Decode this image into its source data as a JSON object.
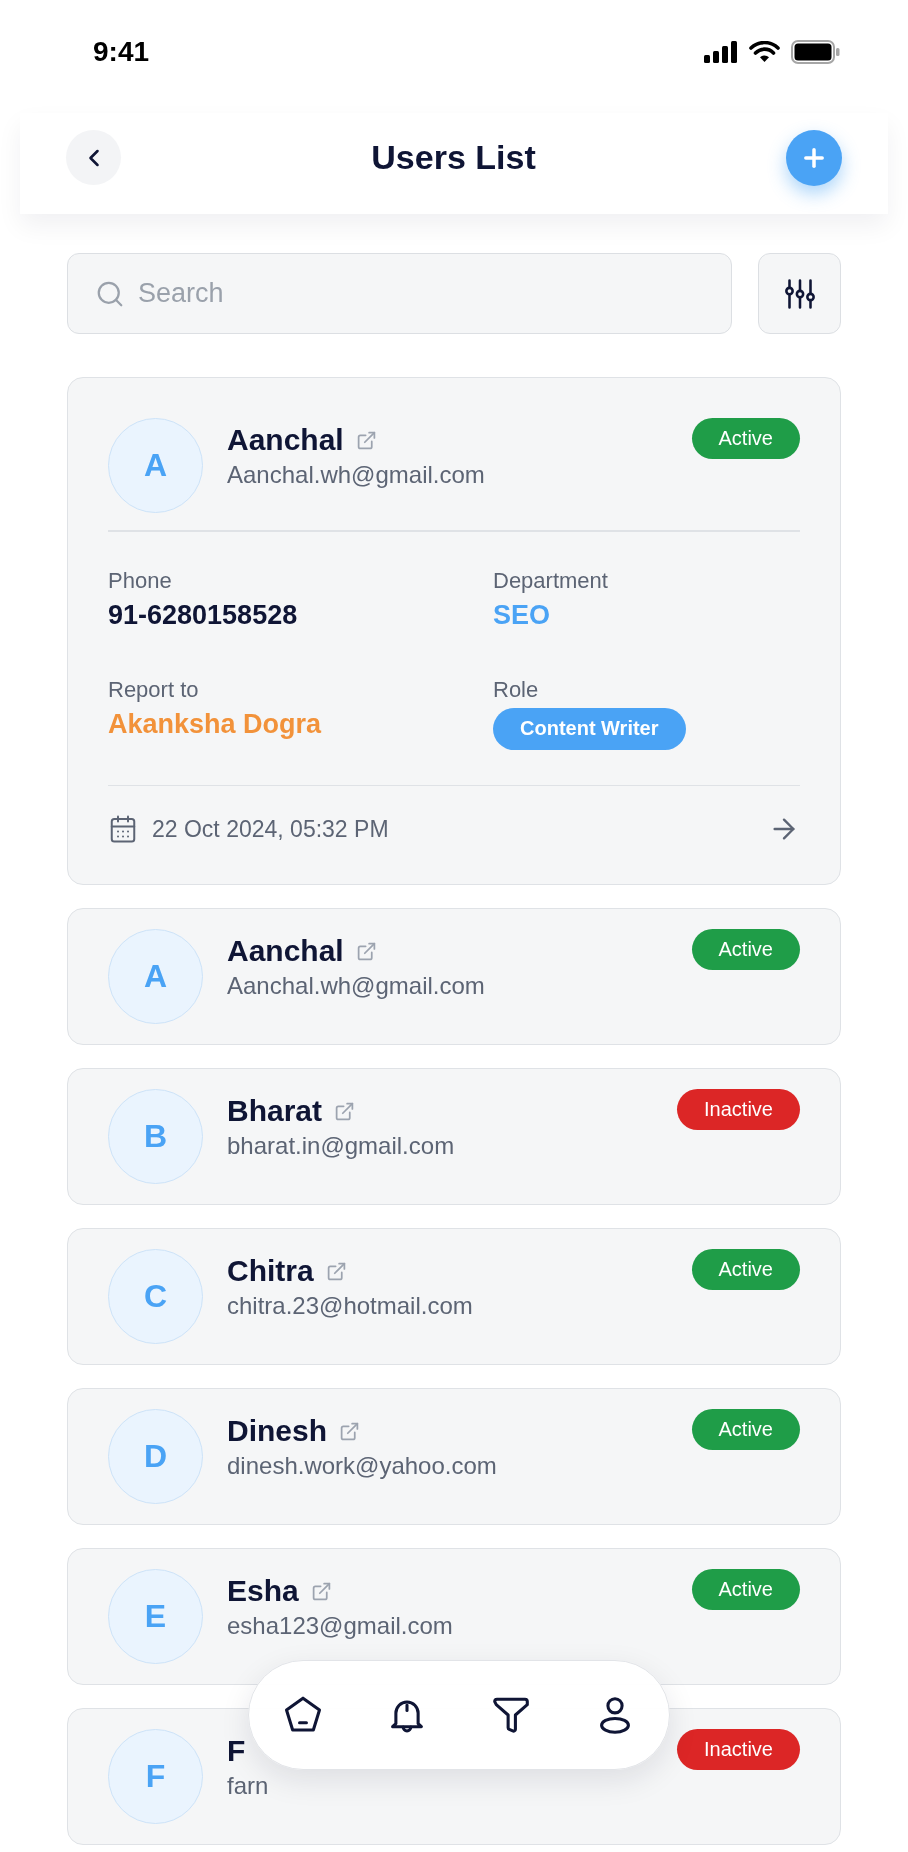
{
  "status_bar": {
    "time": "9:41"
  },
  "header": {
    "title": "Users List"
  },
  "search": {
    "placeholder": "Search"
  },
  "users": [
    {
      "initial": "A",
      "name": "Aanchal",
      "link_icon": true,
      "email": "Aanchal.wh@gmail.com",
      "status": "Active",
      "active": true,
      "fields": [
        {
          "kind": "plain",
          "label": "Phone",
          "value": "91-6280158528"
        },
        {
          "kind": "accent",
          "label": "Department",
          "value": "SEO"
        },
        {
          "kind": "highlight",
          "label": "Report to",
          "value": "Akanksha Dogra"
        },
        {
          "kind": "chip",
          "label": "Role",
          "value": "Content Writer"
        }
      ],
      "date": "22 Oct 2024, 05:32 PM"
    },
    {
      "initial": "A",
      "name": "Aanchal",
      "link_icon": true,
      "email": "Aanchal.wh@gmail.com",
      "status": "Active",
      "active": true
    },
    {
      "initial": "B",
      "name": "Bharat",
      "link_icon": true,
      "email": "bharat.in@gmail.com",
      "status": "Inactive",
      "active": false
    },
    {
      "initial": "C",
      "name": "Chitra",
      "link_icon": true,
      "email": "chitra.23@hotmail.com",
      "status": "Active",
      "active": true
    },
    {
      "initial": "D",
      "name": "Dinesh",
      "link_icon": true,
      "email": "dinesh.work@yahoo.com",
      "status": "Active",
      "active": true
    },
    {
      "initial": "E",
      "name": "Esha",
      "link_icon": true,
      "email": "esha123@gmail.com",
      "status": "Active",
      "active": true
    },
    {
      "initial": "F",
      "name": "F",
      "link_icon": false,
      "email": "farn",
      "status": "Inactive",
      "active": false
    }
  ]
}
